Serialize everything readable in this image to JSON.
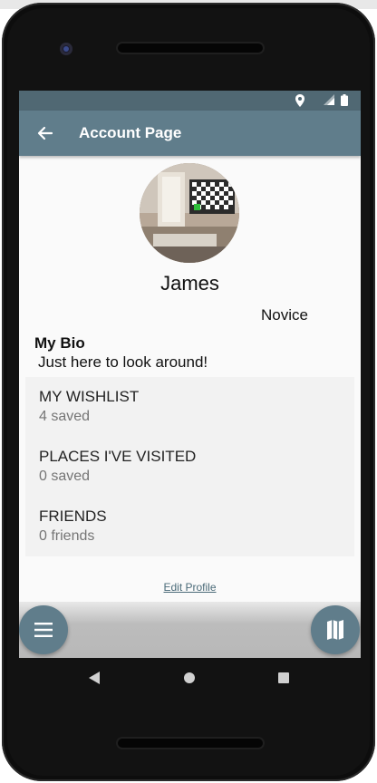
{
  "app_bar": {
    "title": "Account Page"
  },
  "profile": {
    "name": "James",
    "rank": "Novice",
    "bio_heading": "My Bio",
    "bio_text": "Just here to look around!"
  },
  "sections": [
    {
      "title": "MY WISHLIST",
      "subtitle": "4 saved"
    },
    {
      "title": "PLACES I'VE VISITED",
      "subtitle": "0 saved"
    },
    {
      "title": "FRIENDS",
      "subtitle": "0 friends"
    }
  ],
  "actions": {
    "edit_profile": "Edit Profile"
  },
  "icons": {
    "back": "arrow-left-icon",
    "menu": "menu-icon",
    "map": "map-icon",
    "location": "location-pin-icon",
    "signal": "signal-icon",
    "battery": "battery-icon"
  },
  "colors": {
    "app_bar": "#607d8b",
    "status_bar": "#506873",
    "fab": "#607d8b",
    "screen_bg": "#fafafa",
    "list_bg": "#f2f2f2"
  }
}
